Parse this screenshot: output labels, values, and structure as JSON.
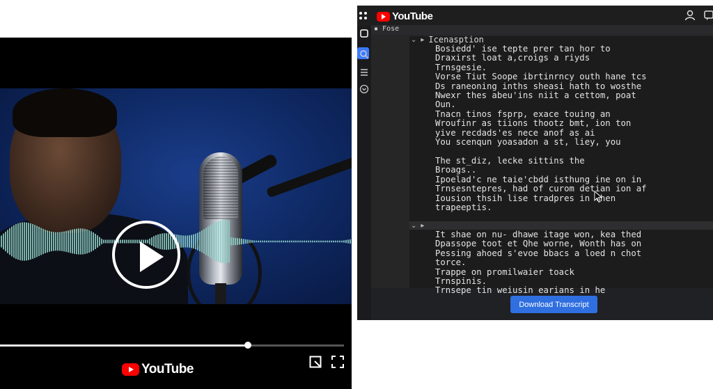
{
  "player": {
    "brand": "YouTube",
    "progress": 0.72
  },
  "window": {
    "brand": "YouTube",
    "breadcrumb": "Fose",
    "segments": [
      {
        "title": "Icenasption",
        "lines": [
          "Bosiedd' ise tepte prer tan hor to",
          "Draxirst loat a,croigs a riyds",
          "Trnsgesie.",
          "Vorse Tiut Soope ibrtinrncy outh hane tcs",
          "Ds raneoning inths sheasi hath to wosthe",
          "Nwexr thes abeu'ins niit a cettom, poat",
          "Oun.",
          "Tnacn tinos fsprp, exace touing an",
          "Wroufinr as tiions thootz bmt, ion ton",
          "yive recdads'es nece anof as ai",
          "You scenqun yoasadon a st, liey, you",
          "",
          "The st_diz, lecke sittins the",
          "Broags..",
          "Ipoelad'c ne taie'cbdd isthung ine on in",
          "Trnsesntepres, had of curom detian ion af",
          "Iousion thsih lise tradpres in then",
          "trapeeptis."
        ]
      },
      {
        "lines": [
          "It shae on nu- dhawe itage won, kea thed",
          "Dpassope toot et Qhe worne, Wonth has on",
          "Pessing ahoed s'evoe bbacs a loed n chot",
          "torce.",
          "Trappe on promilwaier toack",
          "Trnspinis.",
          "Trnsepe tin weiusin earians in he"
        ]
      }
    ],
    "download_label": "Download Transcript"
  },
  "colors": {
    "youtube_red": "#ff0000",
    "accent_blue": "#2f6fe0",
    "panel_dark": "#1c1c1c"
  }
}
